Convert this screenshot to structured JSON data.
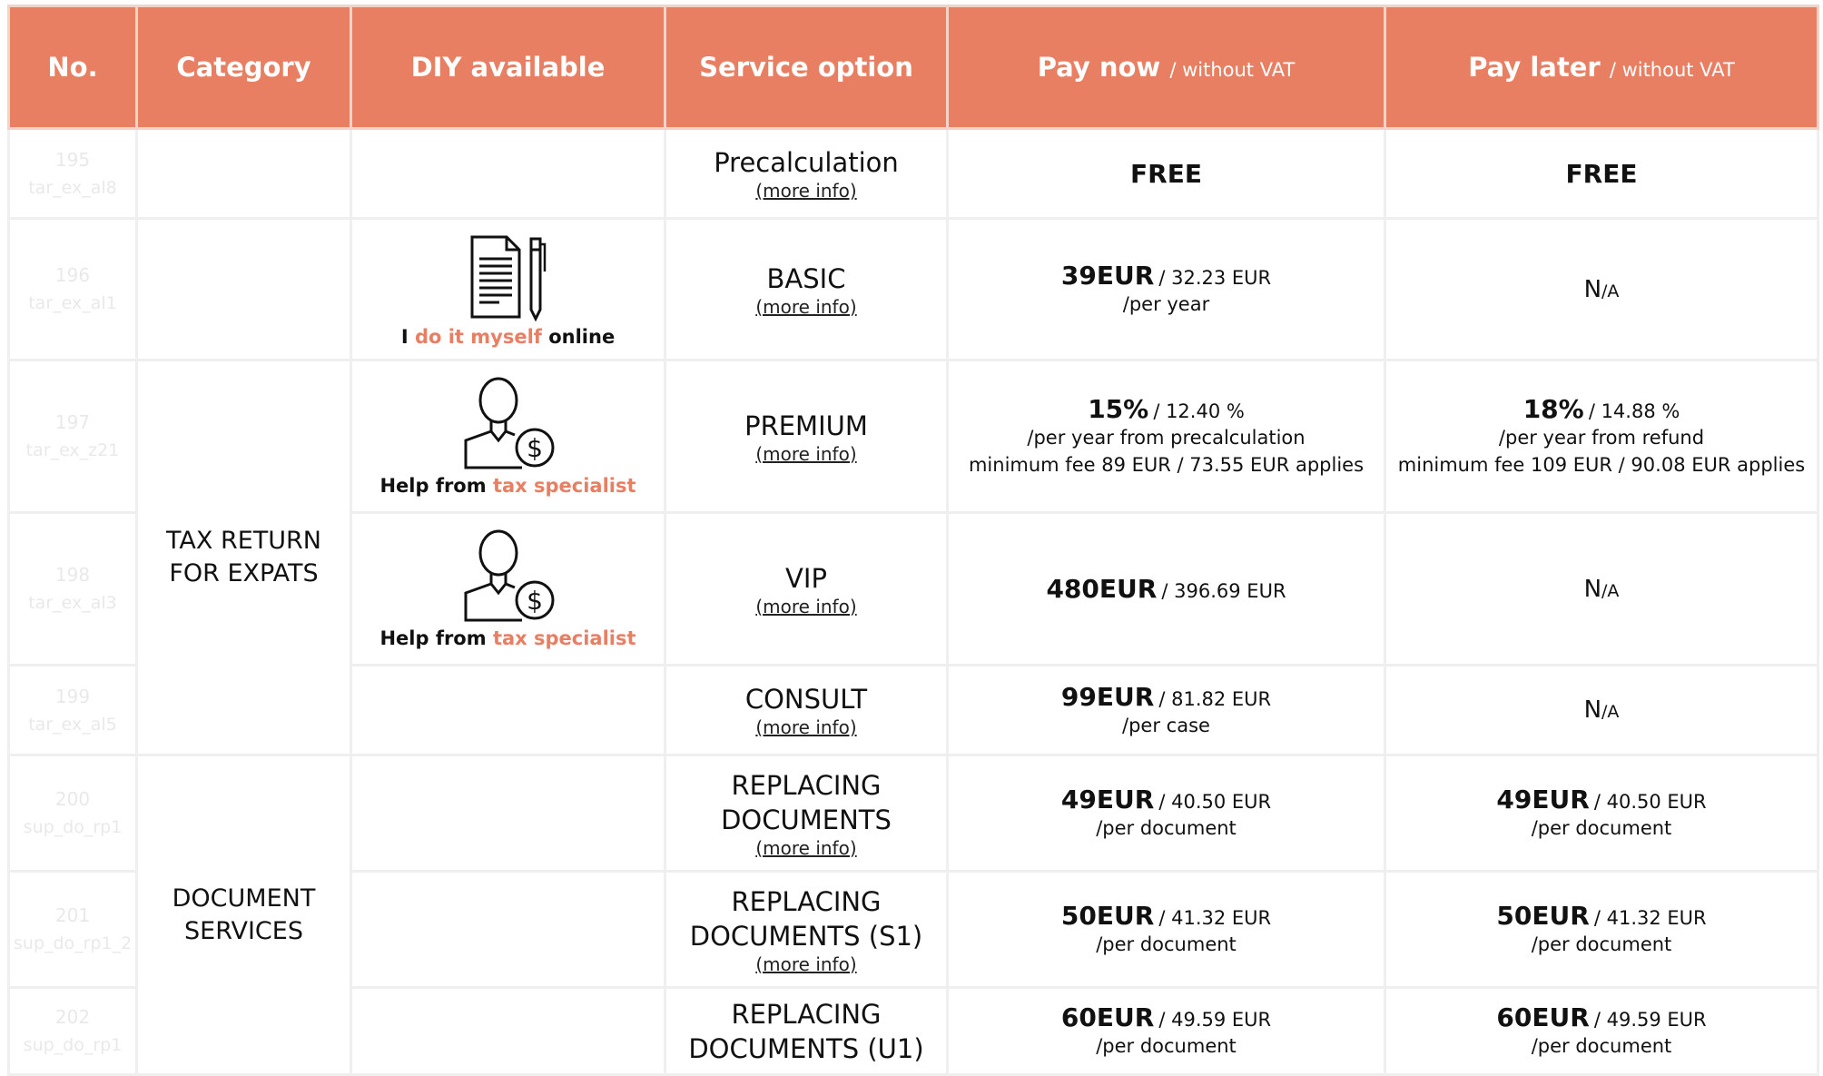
{
  "colors": {
    "header_bg": "#e87f63",
    "accent": "#e87f63",
    "code_text": "#e9e9e9"
  },
  "header": {
    "no": "No.",
    "category": "Category",
    "diy": "DIY available",
    "service": "Service option",
    "pay_now": "Pay now",
    "pay_later": "Pay later",
    "vat_note": "/ without VAT"
  },
  "more_info": "(more info)",
  "categories": {
    "tax": [
      "TAX RETURN",
      "FOR EXPATS"
    ],
    "docs": [
      "DOCUMENT",
      "SERVICES"
    ]
  },
  "diy": {
    "myself": {
      "icon": "document-pen-icon",
      "pre": "I ",
      "accent": "do it myself",
      "post": " online"
    },
    "specialist": {
      "icon": "specialist-dollar-icon",
      "pre": "Help from ",
      "accent": "tax specialist"
    }
  },
  "rows": [
    {
      "no": "195",
      "code": "tar_ex_al8",
      "service": [
        "Precalculation"
      ],
      "now": {
        "free": "FREE"
      },
      "later": {
        "free": "FREE"
      }
    },
    {
      "no": "196",
      "code": "tar_ex_al1",
      "service": [
        "BASIC"
      ],
      "now": {
        "main": "39EUR",
        "net": "/ 32.23 EUR",
        "lines": [
          "/per year"
        ]
      },
      "later": {
        "na_big": "N",
        "na_small": "/A"
      }
    },
    {
      "no": "197",
      "code": "tar_ex_z21",
      "service": [
        "PREMIUM"
      ],
      "now": {
        "main": "15%",
        "net": "/ 12.40 %",
        "lines": [
          "/per year from precalculation",
          "minimum fee 89 EUR / 73.55 EUR applies"
        ]
      },
      "later": {
        "main": "18%",
        "net": "/ 14.88 %",
        "lines": [
          "/per year from refund",
          "minimum fee 109 EUR / 90.08 EUR applies"
        ]
      }
    },
    {
      "no": "198",
      "code": "tar_ex_al3",
      "service": [
        "VIP"
      ],
      "now": {
        "main": "480EUR",
        "net": "/ 396.69 EUR",
        "lines": []
      },
      "later": {
        "na_big": "N",
        "na_small": "/A"
      }
    },
    {
      "no": "199",
      "code": "tar_ex_al5",
      "service": [
        "CONSULT"
      ],
      "now": {
        "main": "99EUR",
        "net": "/ 81.82 EUR",
        "lines": [
          "/per case"
        ]
      },
      "later": {
        "na_big": "N",
        "na_small": "/A"
      }
    },
    {
      "no": "200",
      "code": "sup_do_rp1",
      "service": [
        "REPLACING",
        "DOCUMENTS"
      ],
      "now": {
        "main": "49EUR",
        "net": "/ 40.50 EUR",
        "lines": [
          "/per document"
        ]
      },
      "later": {
        "main": "49EUR",
        "net": "/ 40.50 EUR",
        "lines": [
          "/per document"
        ]
      }
    },
    {
      "no": "201",
      "code": "sup_do_rp1_2",
      "service": [
        "REPLACING",
        "DOCUMENTS (S1)"
      ],
      "now": {
        "main": "50EUR",
        "net": "/ 41.32 EUR",
        "lines": [
          "/per document"
        ]
      },
      "later": {
        "main": "50EUR",
        "net": "/ 41.32 EUR",
        "lines": [
          "/per document"
        ]
      }
    },
    {
      "no": "202",
      "code": "sup_do_rp1",
      "service": [
        "REPLACING",
        "DOCUMENTS (U1)"
      ],
      "now": {
        "main": "60EUR",
        "net": "/ 49.59 EUR",
        "lines": [
          "/per document"
        ]
      },
      "later": {
        "main": "60EUR",
        "net": "/ 49.59 EUR",
        "lines": [
          "/per document"
        ]
      }
    }
  ]
}
